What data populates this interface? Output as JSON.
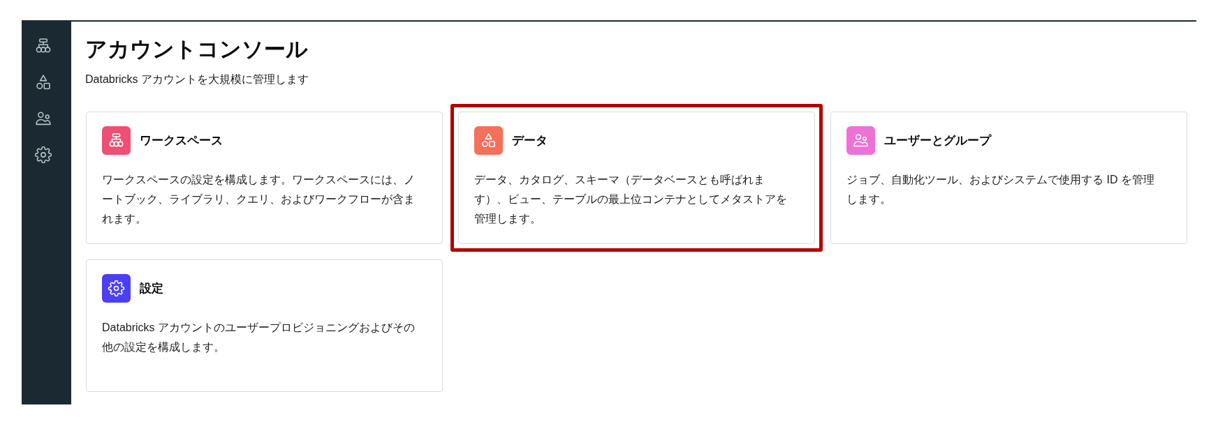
{
  "sidebar": {
    "items": [
      {
        "kind": "workspaces"
      },
      {
        "kind": "data"
      },
      {
        "kind": "users"
      },
      {
        "kind": "settings"
      }
    ]
  },
  "header": {
    "title": "アカウントコンソール",
    "subtitle": "Databricks アカウントを大規模に管理します"
  },
  "cards": [
    {
      "kind": "workspaces",
      "color": "#ec5074",
      "title": "ワークスペース",
      "description": "ワークスペースの設定を構成します。ワークスペースには、ノートブック、ライブラリ、クエリ、およびワークフローが含まれます。",
      "highlighted": false
    },
    {
      "kind": "data",
      "color": "#f4705a",
      "title": "データ",
      "description": "データ、カタログ、スキーマ（データベースとも呼ばれます）、ビュー、テーブルの最上位コンテナとしてメタストアを管理します。",
      "highlighted": true
    },
    {
      "kind": "users",
      "color": "#ee72d6",
      "title": "ユーザーとグループ",
      "description": "ジョブ、自動化ツール、およびシステムで使用する ID を管理します。",
      "highlighted": false
    },
    {
      "kind": "settings",
      "color": "#4c3ff2",
      "title": "設定",
      "description": "Databricks アカウントのユーザープロビジョニングおよびその他の設定を構成します。",
      "highlighted": false
    }
  ]
}
